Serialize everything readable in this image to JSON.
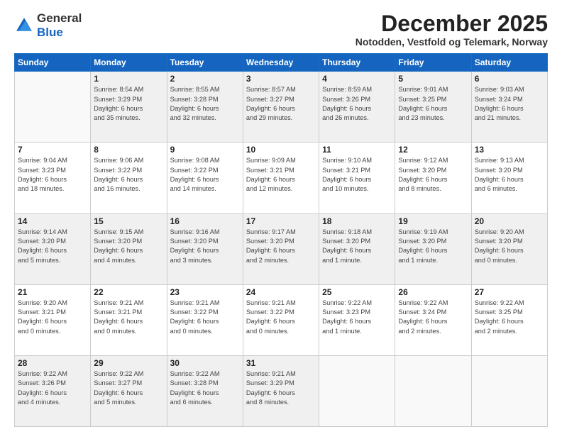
{
  "logo": {
    "general": "General",
    "blue": "Blue"
  },
  "header": {
    "month": "December 2025",
    "location": "Notodden, Vestfold og Telemark, Norway"
  },
  "weekdays": [
    "Sunday",
    "Monday",
    "Tuesday",
    "Wednesday",
    "Thursday",
    "Friday",
    "Saturday"
  ],
  "weeks": [
    [
      {
        "day": "",
        "info": ""
      },
      {
        "day": "1",
        "info": "Sunrise: 8:54 AM\nSunset: 3:29 PM\nDaylight: 6 hours\nand 35 minutes."
      },
      {
        "day": "2",
        "info": "Sunrise: 8:55 AM\nSunset: 3:28 PM\nDaylight: 6 hours\nand 32 minutes."
      },
      {
        "day": "3",
        "info": "Sunrise: 8:57 AM\nSunset: 3:27 PM\nDaylight: 6 hours\nand 29 minutes."
      },
      {
        "day": "4",
        "info": "Sunrise: 8:59 AM\nSunset: 3:26 PM\nDaylight: 6 hours\nand 26 minutes."
      },
      {
        "day": "5",
        "info": "Sunrise: 9:01 AM\nSunset: 3:25 PM\nDaylight: 6 hours\nand 23 minutes."
      },
      {
        "day": "6",
        "info": "Sunrise: 9:03 AM\nSunset: 3:24 PM\nDaylight: 6 hours\nand 21 minutes."
      }
    ],
    [
      {
        "day": "7",
        "info": "Sunrise: 9:04 AM\nSunset: 3:23 PM\nDaylight: 6 hours\nand 18 minutes."
      },
      {
        "day": "8",
        "info": "Sunrise: 9:06 AM\nSunset: 3:22 PM\nDaylight: 6 hours\nand 16 minutes."
      },
      {
        "day": "9",
        "info": "Sunrise: 9:08 AM\nSunset: 3:22 PM\nDaylight: 6 hours\nand 14 minutes."
      },
      {
        "day": "10",
        "info": "Sunrise: 9:09 AM\nSunset: 3:21 PM\nDaylight: 6 hours\nand 12 minutes."
      },
      {
        "day": "11",
        "info": "Sunrise: 9:10 AM\nSunset: 3:21 PM\nDaylight: 6 hours\nand 10 minutes."
      },
      {
        "day": "12",
        "info": "Sunrise: 9:12 AM\nSunset: 3:20 PM\nDaylight: 6 hours\nand 8 minutes."
      },
      {
        "day": "13",
        "info": "Sunrise: 9:13 AM\nSunset: 3:20 PM\nDaylight: 6 hours\nand 6 minutes."
      }
    ],
    [
      {
        "day": "14",
        "info": "Sunrise: 9:14 AM\nSunset: 3:20 PM\nDaylight: 6 hours\nand 5 minutes."
      },
      {
        "day": "15",
        "info": "Sunrise: 9:15 AM\nSunset: 3:20 PM\nDaylight: 6 hours\nand 4 minutes."
      },
      {
        "day": "16",
        "info": "Sunrise: 9:16 AM\nSunset: 3:20 PM\nDaylight: 6 hours\nand 3 minutes."
      },
      {
        "day": "17",
        "info": "Sunrise: 9:17 AM\nSunset: 3:20 PM\nDaylight: 6 hours\nand 2 minutes."
      },
      {
        "day": "18",
        "info": "Sunrise: 9:18 AM\nSunset: 3:20 PM\nDaylight: 6 hours\nand 1 minute."
      },
      {
        "day": "19",
        "info": "Sunrise: 9:19 AM\nSunset: 3:20 PM\nDaylight: 6 hours\nand 1 minute."
      },
      {
        "day": "20",
        "info": "Sunrise: 9:20 AM\nSunset: 3:20 PM\nDaylight: 6 hours\nand 0 minutes."
      }
    ],
    [
      {
        "day": "21",
        "info": "Sunrise: 9:20 AM\nSunset: 3:21 PM\nDaylight: 6 hours\nand 0 minutes."
      },
      {
        "day": "22",
        "info": "Sunrise: 9:21 AM\nSunset: 3:21 PM\nDaylight: 6 hours\nand 0 minutes."
      },
      {
        "day": "23",
        "info": "Sunrise: 9:21 AM\nSunset: 3:22 PM\nDaylight: 6 hours\nand 0 minutes."
      },
      {
        "day": "24",
        "info": "Sunrise: 9:21 AM\nSunset: 3:22 PM\nDaylight: 6 hours\nand 0 minutes."
      },
      {
        "day": "25",
        "info": "Sunrise: 9:22 AM\nSunset: 3:23 PM\nDaylight: 6 hours\nand 1 minute."
      },
      {
        "day": "26",
        "info": "Sunrise: 9:22 AM\nSunset: 3:24 PM\nDaylight: 6 hours\nand 2 minutes."
      },
      {
        "day": "27",
        "info": "Sunrise: 9:22 AM\nSunset: 3:25 PM\nDaylight: 6 hours\nand 2 minutes."
      }
    ],
    [
      {
        "day": "28",
        "info": "Sunrise: 9:22 AM\nSunset: 3:26 PM\nDaylight: 6 hours\nand 4 minutes."
      },
      {
        "day": "29",
        "info": "Sunrise: 9:22 AM\nSunset: 3:27 PM\nDaylight: 6 hours\nand 5 minutes."
      },
      {
        "day": "30",
        "info": "Sunrise: 9:22 AM\nSunset: 3:28 PM\nDaylight: 6 hours\nand 6 minutes."
      },
      {
        "day": "31",
        "info": "Sunrise: 9:21 AM\nSunset: 3:29 PM\nDaylight: 6 hours\nand 8 minutes."
      },
      {
        "day": "",
        "info": ""
      },
      {
        "day": "",
        "info": ""
      },
      {
        "day": "",
        "info": ""
      }
    ]
  ]
}
